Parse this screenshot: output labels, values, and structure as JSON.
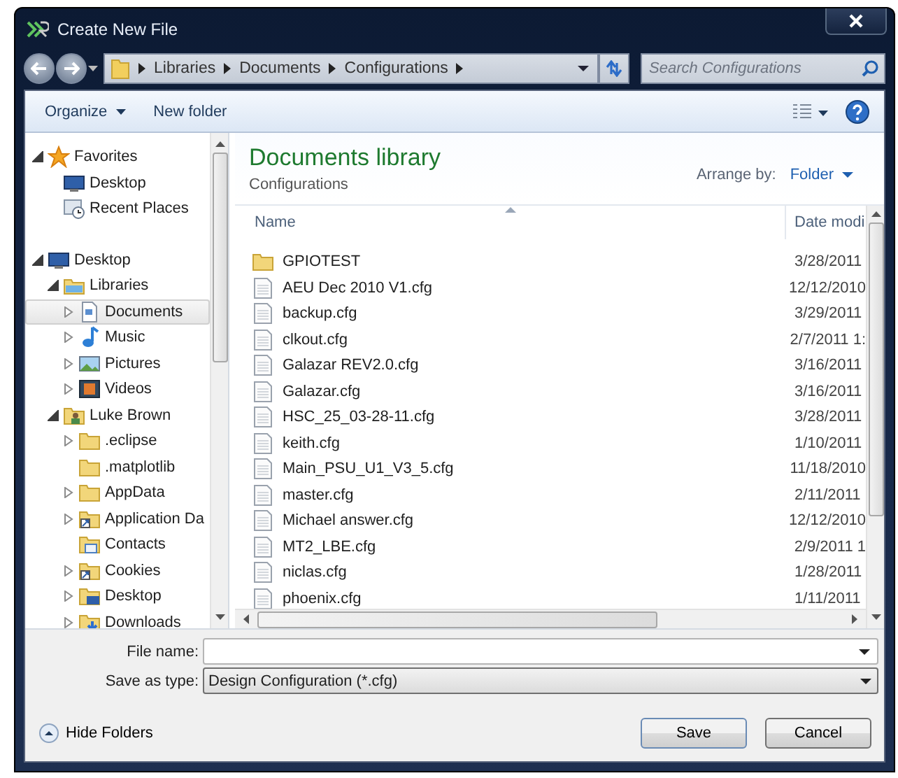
{
  "window": {
    "title": "Create New File"
  },
  "address": {
    "crumbs": [
      "Libraries",
      "Documents",
      "Configurations"
    ]
  },
  "search": {
    "placeholder": "Search Configurations"
  },
  "toolbar": {
    "buttons": [
      {
        "label": "Organize",
        "dropdown": true
      },
      {
        "label": "New folder",
        "dropdown": false
      }
    ]
  },
  "nav": {
    "items": [
      {
        "label": "Favorites",
        "kind": "star",
        "expandable": true,
        "expanded": true,
        "selected": false,
        "children": [
          {
            "label": "Desktop",
            "kind": "monitor",
            "expandable": false,
            "selected": false
          },
          {
            "label": "Recent Places",
            "kind": "recent",
            "expandable": false,
            "selected": false
          }
        ]
      },
      {
        "label": "Desktop",
        "kind": "monitor",
        "expandable": true,
        "expanded": true,
        "selected": false,
        "children": [
          {
            "label": "Libraries",
            "kind": "library",
            "expandable": true,
            "expanded": true,
            "selected": false,
            "children": [
              {
                "label": "Documents",
                "kind": "document",
                "expandable": true,
                "expanded": false,
                "selected": true
              },
              {
                "label": "Music",
                "kind": "music",
                "expandable": true,
                "expanded": false,
                "selected": false
              },
              {
                "label": "Pictures",
                "kind": "pictures",
                "expandable": true,
                "expanded": false,
                "selected": false
              },
              {
                "label": "Videos",
                "kind": "videos",
                "expandable": true,
                "expanded": false,
                "selected": false
              }
            ]
          },
          {
            "label": "Luke Brown",
            "kind": "user",
            "expandable": true,
            "expanded": true,
            "selected": false,
            "children": [
              {
                "label": ".eclipse",
                "kind": "folder",
                "expandable": true,
                "expanded": false,
                "selected": false
              },
              {
                "label": ".matplotlib",
                "kind": "folder",
                "expandable": false,
                "selected": false
              },
              {
                "label": "AppData",
                "kind": "folder",
                "expandable": true,
                "expanded": false,
                "selected": false
              },
              {
                "label": "Application Da",
                "kind": "shortcut",
                "expandable": true,
                "expanded": false,
                "selected": false
              },
              {
                "label": "Contacts",
                "kind": "contacts",
                "expandable": false,
                "selected": false
              },
              {
                "label": "Cookies",
                "kind": "shortcut",
                "expandable": true,
                "expanded": false,
                "selected": false
              },
              {
                "label": "Desktop",
                "kind": "desktop-folder",
                "expandable": true,
                "expanded": false,
                "selected": false
              },
              {
                "label": "Downloads",
                "kind": "downloads",
                "expandable": true,
                "expanded": false,
                "selected": false
              }
            ]
          }
        ]
      }
    ]
  },
  "library": {
    "title": "Documents library",
    "subtitle": "Configurations",
    "arrange_label": "Arrange by:",
    "arrange_value": "Folder"
  },
  "columns": [
    {
      "label": "Name",
      "sorted": true
    },
    {
      "label": "Date modi",
      "sorted": false
    }
  ],
  "files": [
    {
      "kind": "folder",
      "name": "GPIOTEST",
      "date": "3/28/2011"
    },
    {
      "kind": "file",
      "name": "AEU Dec 2010 V1.cfg",
      "date": "12/12/2010"
    },
    {
      "kind": "file",
      "name": "backup.cfg",
      "date": "3/29/2011"
    },
    {
      "kind": "file",
      "name": "clkout.cfg",
      "date": "2/7/2011 1:"
    },
    {
      "kind": "file",
      "name": "Galazar REV2.0.cfg",
      "date": "3/16/2011"
    },
    {
      "kind": "file",
      "name": "Galazar.cfg",
      "date": "3/16/2011"
    },
    {
      "kind": "file",
      "name": "HSC_25_03-28-11.cfg",
      "date": "3/28/2011"
    },
    {
      "kind": "file",
      "name": "keith.cfg",
      "date": "1/10/2011"
    },
    {
      "kind": "file",
      "name": "Main_PSU_U1_V3_5.cfg",
      "date": "11/18/2010"
    },
    {
      "kind": "file",
      "name": "master.cfg",
      "date": "2/11/2011"
    },
    {
      "kind": "file",
      "name": "Michael answer.cfg",
      "date": "12/12/2010"
    },
    {
      "kind": "file",
      "name": "MT2_LBE.cfg",
      "date": "2/9/2011 1"
    },
    {
      "kind": "file",
      "name": "niclas.cfg",
      "date": "1/28/2011"
    },
    {
      "kind": "file",
      "name": "phoenix.cfg",
      "date": "1/11/2011"
    }
  ],
  "form": {
    "file_name": {
      "label": "File name:"
    },
    "save_type": {
      "label": "Save as type:",
      "value": "Design Configuration (*.cfg)"
    }
  },
  "hide_folders": "Hide Folders",
  "buttons": [
    {
      "label": "Save",
      "kind": "default"
    },
    {
      "label": "Cancel",
      "kind": "normal"
    }
  ]
}
